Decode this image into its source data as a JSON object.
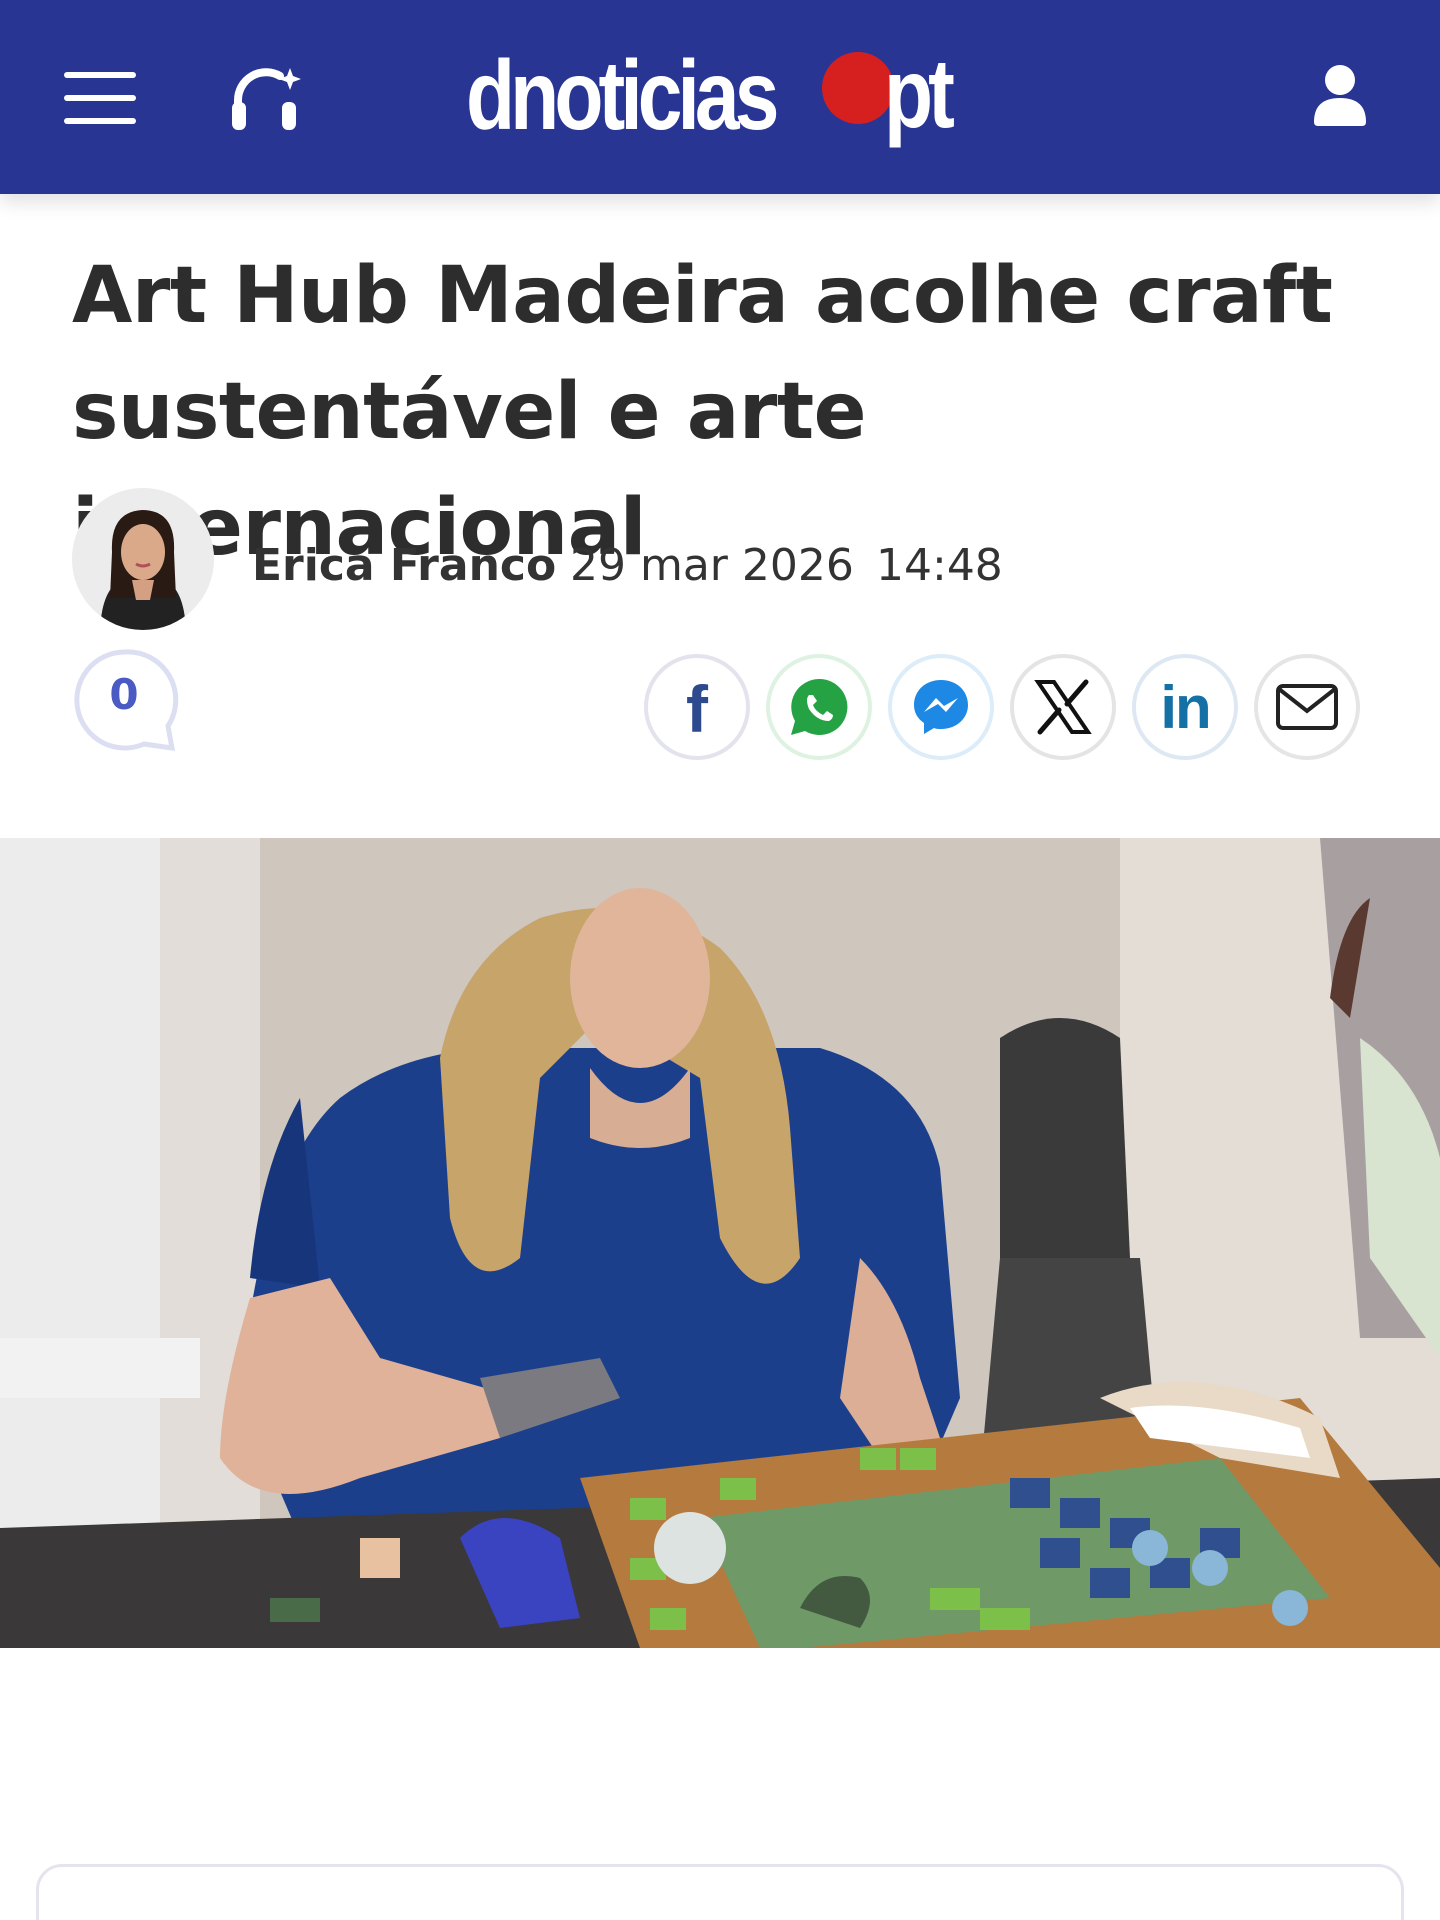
{
  "header": {
    "menu_icon": "hamburger-menu-icon",
    "audio_icon": "headphones-sparkle-icon",
    "logo": {
      "left": "dnoticias",
      "right": "pt"
    },
    "user_icon": "user-icon",
    "background": "#283593",
    "logo_dot_color": "#d62020"
  },
  "article": {
    "title": "Art Hub Madeira acolhe craft sustentável e arte internacional",
    "author": "Erica Franco",
    "date": "29 mar 2026",
    "time": "14:48",
    "comments_count": "0",
    "photo_alt": "Mulher a criar um mosaico de azulejos verdes e azuis sobre uma moldura de madeira"
  },
  "share": [
    {
      "name": "facebook",
      "icon": "facebook-icon",
      "color": "#2d4a8f"
    },
    {
      "name": "whatsapp",
      "icon": "whatsapp-icon",
      "color": "#25a344"
    },
    {
      "name": "messenger",
      "icon": "messenger-icon",
      "color": "#1e88e5"
    },
    {
      "name": "x",
      "icon": "x-icon",
      "color": "#111111"
    },
    {
      "name": "linkedin",
      "icon": "linkedin-icon",
      "color": "#1570a6"
    },
    {
      "name": "email",
      "icon": "email-icon",
      "color": "#222222"
    }
  ]
}
